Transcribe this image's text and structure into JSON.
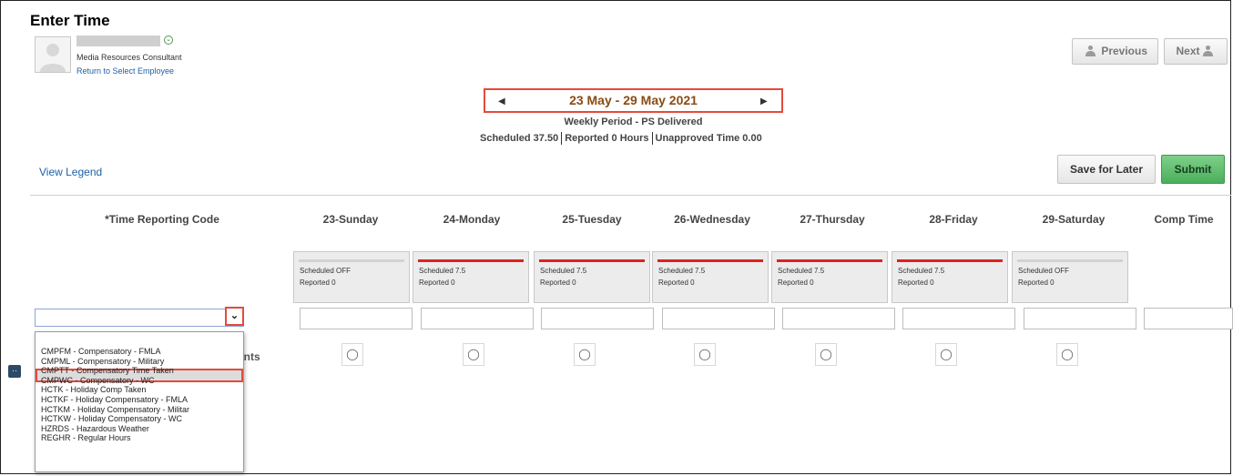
{
  "page": {
    "title": "Enter Time"
  },
  "employee": {
    "job_title": "Media Resources Consultant",
    "return_link": "Return to Select Employee"
  },
  "nav": {
    "previous": "Previous",
    "next": "Next"
  },
  "period": {
    "range": "23 May - 29 May 2021",
    "type": "Weekly Period - PS Delivered"
  },
  "stats": {
    "scheduled": "Scheduled  37.50",
    "reported": "Reported  0 Hours",
    "unapproved": "Unapproved Time  0.00"
  },
  "legend": "View Legend",
  "actions": {
    "save": "Save for Later",
    "submit": "Submit"
  },
  "columns": {
    "trc": "*Time Reporting Code",
    "days": [
      "23-Sunday",
      "24-Monday",
      "25-Tuesday",
      "26-Wednesday",
      "27-Thursday",
      "28-Friday",
      "29-Saturday"
    ],
    "comp": "Comp Time"
  },
  "days": [
    {
      "scheduled": "Scheduled OFF",
      "reported": "Reported  0",
      "bar": "gray"
    },
    {
      "scheduled": "Scheduled 7.5",
      "reported": "Reported  0",
      "bar": "red"
    },
    {
      "scheduled": "Scheduled 7.5",
      "reported": "Reported  0",
      "bar": "red"
    },
    {
      "scheduled": "Scheduled 7.5",
      "reported": "Reported  0",
      "bar": "red"
    },
    {
      "scheduled": "Scheduled 7.5",
      "reported": "Reported  0",
      "bar": "red"
    },
    {
      "scheduled": "Scheduled 7.5",
      "reported": "Reported  0",
      "bar": "red"
    },
    {
      "scheduled": "Scheduled OFF",
      "reported": "Reported  0",
      "bar": "gray"
    }
  ],
  "comments_label_visible": "ents",
  "trc_options": [
    "CMPFM - Compensatory - FMLA",
    "CMPML - Compensatory - Military",
    "CMPTT - Compensatory Time Taken",
    "CMPWC - Compensatory - WC",
    "HCTK - Holiday Comp Taken",
    "HCTKF - Holiday Compensatory - FMLA",
    "HCTKM - Holiday Compensatory - Militar",
    "HCTKW - Holiday Compensatory - WC",
    "HZRDS - Hazardous Weather",
    "REGHR - Regular Hours"
  ],
  "trc_highlighted": "CMPTT - Compensatory Time Taken",
  "colors": {
    "period_text": "#8a4b14",
    "highlight_border": "#e34b3b",
    "submit": "#4bae5c",
    "link": "#1f5fa8",
    "scheduled_bar": "#dd2222"
  }
}
